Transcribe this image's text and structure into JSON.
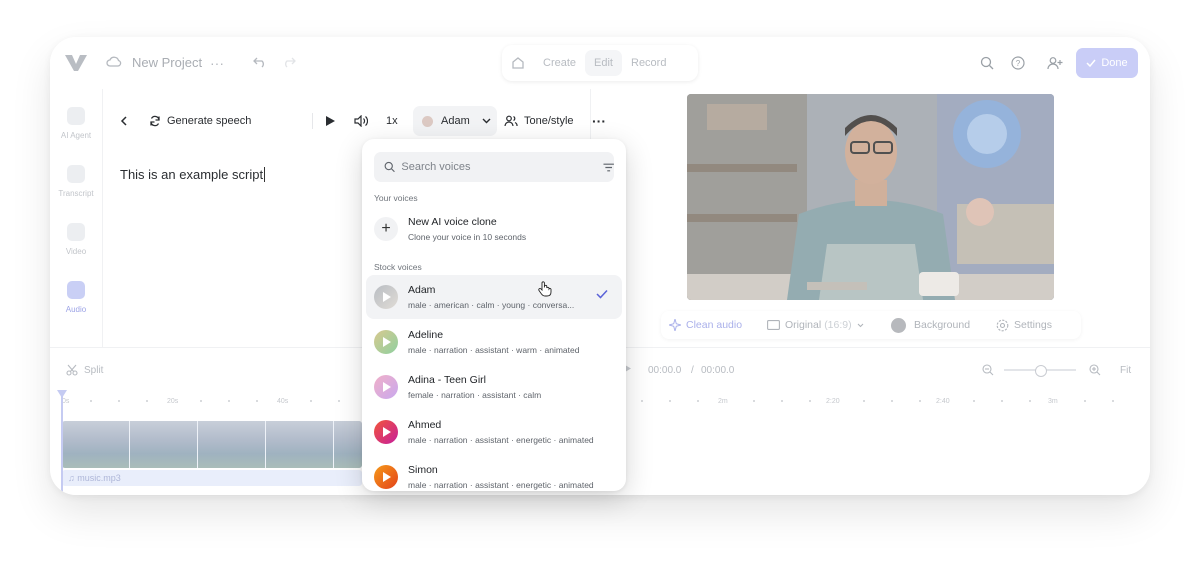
{
  "header": {
    "project_title": "New Project",
    "modes": [
      "Create",
      "Edit",
      "Record"
    ],
    "active_mode": "Edit",
    "done_label": "Done",
    "brand_color": "#6b72e8"
  },
  "sidebar": {
    "items": [
      {
        "label": "AI Agent",
        "icon": "ai-agent-icon"
      },
      {
        "label": "Transcript",
        "icon": "transcript-icon"
      },
      {
        "label": "Video",
        "icon": "video-icon"
      },
      {
        "label": "Audio",
        "icon": "audio-icon"
      }
    ],
    "active": "Audio"
  },
  "editor": {
    "generate_label": "Generate speech",
    "speed": "1x",
    "voice": "Adam",
    "tone_label": "Tone/style",
    "script_text": "This is an example script"
  },
  "preview": {
    "clean_audio": "Clean audio",
    "ratio_label": "Original",
    "ratio_value": "(16:9)",
    "background": "Background",
    "settings": "Settings"
  },
  "timeline": {
    "split_label": "Split",
    "current_time": "00:00.0",
    "separator": "/",
    "total_time": "00:00.0",
    "fit_label": "Fit",
    "ruler_left": [
      "0s",
      "20s",
      "40s"
    ],
    "ruler_right": [
      "2m",
      "2:20",
      "2:40",
      "3m"
    ],
    "audio_file": "music.mp3"
  },
  "voice_menu": {
    "search_placeholder": "Search voices",
    "your_voices_label": "Your voices",
    "clone": {
      "name": "New AI voice clone",
      "desc": "Clone your voice in 10 seconds"
    },
    "stock_label": "Stock voices",
    "voices": [
      {
        "name": "Adam",
        "desc": "male · american · calm · young · conversa...",
        "color": "#c9ccd2",
        "selected": true
      },
      {
        "name": "Adeline",
        "desc": "male · narration · assistant · warm · animated",
        "color": "#b7d39a",
        "selected": false
      },
      {
        "name": "Adina - Teen Girl",
        "desc": "female · narration · assistant · calm",
        "color": "#e6a9d8",
        "selected": false
      },
      {
        "name": "Ahmed",
        "desc": "male · narration · assistant · energetic · animated",
        "color": "#e53b8f",
        "selected": false
      },
      {
        "name": "Simon",
        "desc": "male · narration · assistant · energetic · animated",
        "color": "#ef6a1a",
        "selected": false
      }
    ]
  }
}
